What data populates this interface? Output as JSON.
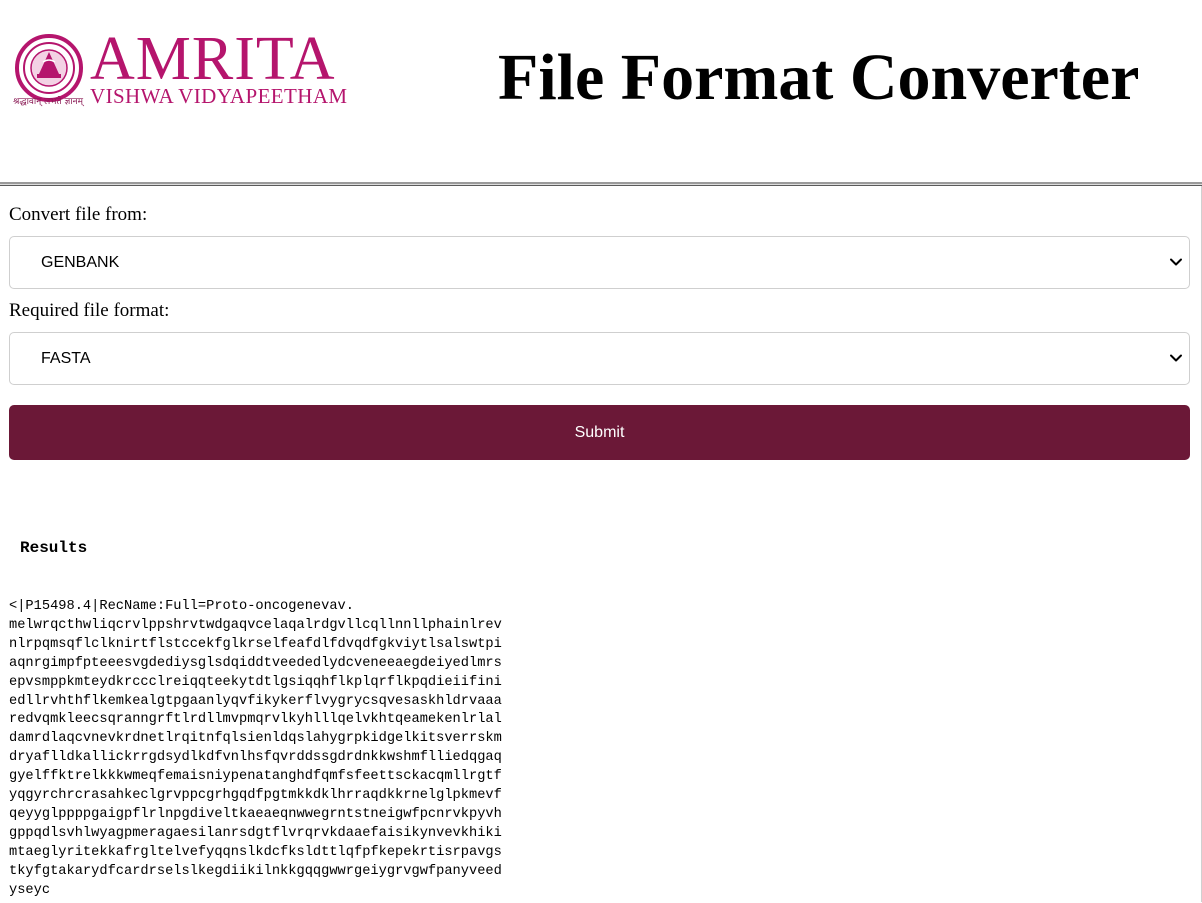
{
  "header": {
    "logo_word": "AMRITA",
    "logo_sub": "VISHWA VIDYAPEETHAM",
    "logo_motto": "श्रद्धावान् लभते ज्ञानम्",
    "title": "File Format Converter"
  },
  "form": {
    "from_label": "Convert file from:",
    "from_value": "GENBANK",
    "to_label": "Required file format:",
    "to_value": "FASTA",
    "submit_label": "Submit"
  },
  "results": {
    "heading": "Results",
    "lines": [
      "<|P15498.4|RecName:Full=Proto-oncogenevav.",
      "melwrqcthwliqcrvlppshrvtwdgaqvcelaqalrdgvllcqllnnllphainlrev",
      "nlrpqmsqflclknirtflstccekfglkrselfeafdlfdvqdfgkviytlsalswtpi",
      "aqnrgimpfpteeesvgdediysglsdqiddtveededlydcveneeaegdeiyedlmrs",
      "epvsmppkmteydkrccclreiqqteekytdtlgsiqqhflkplqrflkpqdieiifini",
      "edllrvhthflkemkealgtpgaanlyqvfikykerflvygrycsqvesaskhldrvaaa",
      "redvqmkleecsqranngrftlrdllmvpmqrvlkyhlllqelvkhtqeamekenlrlal",
      "damrdlaqcvnevkrdnetlrqitnfqlsienldqslahygrpkidgelkitsverrskm",
      "dryaflldkallickrrgdsydlkdfvnlhsfqvrddssgdrdnkkwshmflliedqgaq",
      "gyelffktrelkkkwmeqfemaisniypenatanghdfqmfsfeettsckacqmllrgtf",
      "yqgyrchrcrasahkeclgrvppcgrhgqdfpgtmkkdklhrraqdkkrnelglpkmevf",
      "qeyyglppppgaigpflrlnpgdiveltkaeaeqnwwegrntstneigwfpcnrvkpyvh",
      "gppqdlsvhlwyagpmeragaesilanrsdgtflvrqrvkdaaefaisikynvevkhiki",
      "mtaeglyritekkafrgltelvefyqqnslkdcfksldttlqfpfkepekrtisrpavgs",
      "tkyfgtakarydfcardrselslkegdiikilnkkgqqgwwrgeiygrvgwfpanyveed",
      "yseyc"
    ]
  },
  "colors": {
    "brand_magenta": "#b5156d",
    "submit_bg": "#6b1837"
  }
}
